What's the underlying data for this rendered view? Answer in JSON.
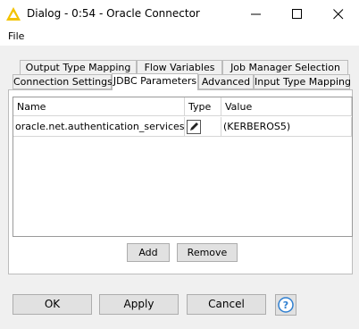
{
  "window": {
    "title": "Dialog - 0:54 - Oracle Connector",
    "icons": [
      "knime-node-icon",
      "minimize-icon",
      "maximize-icon",
      "close-icon"
    ]
  },
  "menu": {
    "file": "File"
  },
  "tabs_back": [
    "Output Type Mapping",
    "Flow Variables",
    "Job Manager Selection"
  ],
  "tabs_front": [
    "Connection Settings",
    "JDBC Parameters",
    "Advanced",
    "Input Type Mapping"
  ],
  "active_tab": "JDBC Parameters",
  "table": {
    "columns": [
      "Name",
      "Type",
      "Value"
    ],
    "rows": [
      {
        "name": "oracle.net.authentication_services",
        "type_icon": "edit-icon",
        "value": "(KERBEROS5)"
      }
    ]
  },
  "table_buttons": {
    "add": "Add",
    "remove": "Remove"
  },
  "footer": {
    "ok": "OK",
    "apply": "Apply",
    "cancel": "Cancel",
    "help_icon": "help-icon"
  },
  "colors": {
    "icon_yellow": "#f3c300",
    "help_blue": "#2f7fd0"
  }
}
